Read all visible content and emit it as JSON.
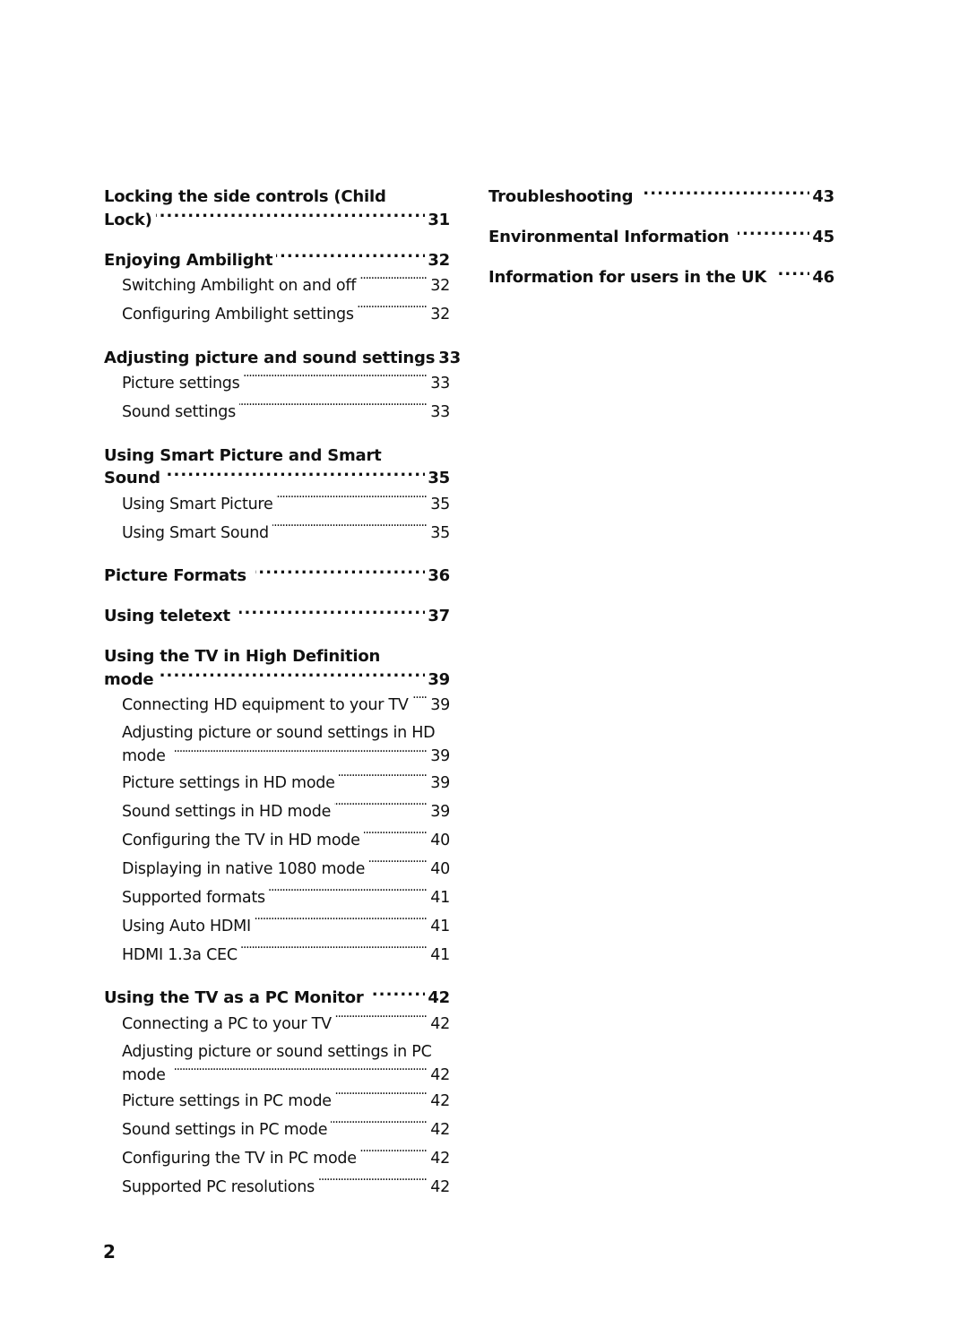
{
  "toc": {
    "left": [
      {
        "title_line1": "Locking the side controls (Child",
        "title_line2": "Lock)",
        "page": "31",
        "subs": []
      },
      {
        "title_line2": "Enjoying Ambilight",
        "page": "32",
        "subs": [
          {
            "title": "Switching Ambilight on and off",
            "page": "32"
          },
          {
            "title": "Configuring Ambilight settings",
            "page": "32"
          }
        ]
      },
      {
        "title_line2": "Adjusting picture and sound settings",
        "page": "33",
        "subs": [
          {
            "title": "Picture settings",
            "page": "33"
          },
          {
            "title": "Sound settings",
            "page": "33"
          }
        ]
      },
      {
        "title_line1": "Using Smart Picture and Smart",
        "title_line2": "Sound",
        "page": "35",
        "subs": [
          {
            "title": "Using Smart Picture",
            "page": "35"
          },
          {
            "title": "Using Smart Sound",
            "page": "35"
          }
        ]
      },
      {
        "title_line2": "Picture Formats",
        "page": "36",
        "subs": []
      },
      {
        "title_line2": "Using teletext",
        "page": "37",
        "subs": []
      },
      {
        "title_line1": "Using the TV in High Definition",
        "title_line2": "mode",
        "page": "39",
        "subs": [
          {
            "title": "Connecting HD equipment to your TV",
            "page": "39"
          },
          {
            "title_line1": "Adjusting picture or sound settings in HD",
            "title": "mode",
            "page": "39"
          },
          {
            "title": "Picture settings in HD mode",
            "page": "39"
          },
          {
            "title": "Sound settings in HD mode",
            "page": "39"
          },
          {
            "title": "Configuring the TV in HD mode",
            "page": "40"
          },
          {
            "title": "Displaying in native 1080 mode",
            "page": "40"
          },
          {
            "title": "Supported formats",
            "page": "41"
          },
          {
            "title": "Using Auto HDMI",
            "page": "41"
          },
          {
            "title": "HDMI 1.3a CEC",
            "page": "41"
          }
        ]
      },
      {
        "title_line2": "Using the TV as a PC Monitor",
        "page": "42",
        "subs": [
          {
            "title": "Connecting a PC to your TV",
            "page": "42"
          },
          {
            "title_line1": "Adjusting picture or sound settings in PC",
            "title": "mode",
            "page": "42"
          },
          {
            "title": "Picture settings in PC mode",
            "page": "42"
          },
          {
            "title": "Sound settings in PC mode",
            "page": "42"
          },
          {
            "title": "Configuring the TV in PC mode",
            "page": "42"
          },
          {
            "title": "Supported PC resolutions",
            "page": "42"
          }
        ]
      }
    ],
    "right": [
      {
        "title": "Troubleshooting",
        "page": "43"
      },
      {
        "title": "Environmental Information",
        "page": "45"
      },
      {
        "title": "Information for users in the UK",
        "page": "46"
      }
    ]
  },
  "page_number": "2"
}
